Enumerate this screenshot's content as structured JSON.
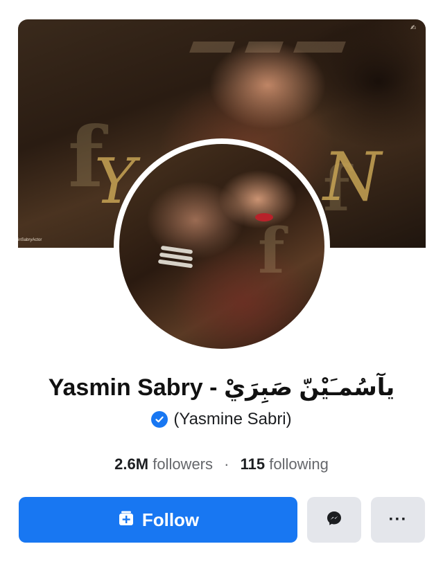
{
  "cover": {
    "credit_text": "inSabryActor",
    "decor_text": "Y N",
    "corner_icon": "lettering-mark-icon"
  },
  "profile": {
    "name": "Yasmin Sabry - يآسُمـَيْنّ صَبِرَيْ",
    "alt_name": "(Yasmine Sabri)",
    "verified": true
  },
  "stats": {
    "followers_count": "2.6M",
    "followers_label": "followers",
    "separator": "·",
    "following_count": "115",
    "following_label": "following"
  },
  "actions": {
    "follow_label": "Follow",
    "follow_icon": "follow-add-icon",
    "message_icon": "messenger-icon",
    "more_label": "···",
    "more_icon": "more-options-icon"
  },
  "colors": {
    "accent": "#1877f2",
    "secondary_button": "#e4e6eb",
    "muted_text": "#65676b"
  }
}
